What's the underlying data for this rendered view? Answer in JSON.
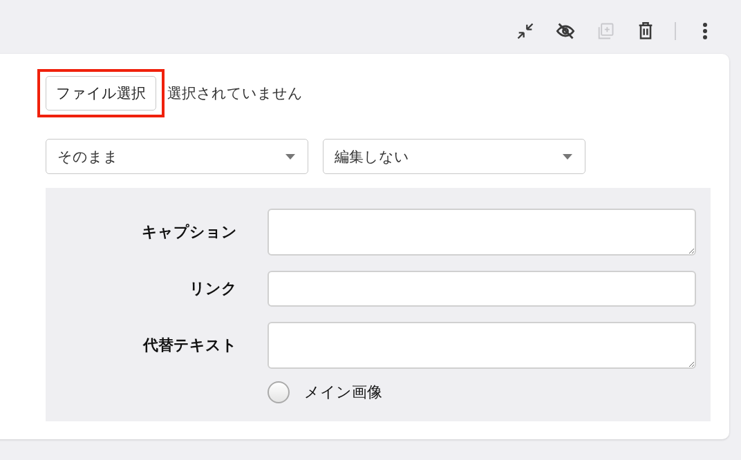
{
  "toolbar": [
    {
      "kind": "collapse",
      "disabled": false
    },
    {
      "kind": "hide",
      "disabled": false
    },
    {
      "kind": "duplicate",
      "disabled": true
    },
    {
      "kind": "delete",
      "disabled": false
    },
    {
      "kind": "more",
      "disabled": false
    }
  ],
  "file_picker": {
    "button": "ファイル選択",
    "status": "選択されていません",
    "highlighted": true
  },
  "selects": [
    {
      "value": "そのまま"
    },
    {
      "value": "編集しない"
    }
  ],
  "fields": [
    {
      "label": "キャプション",
      "kind": "textarea"
    },
    {
      "label": "リンク",
      "kind": "input"
    },
    {
      "label": "代替テキスト",
      "kind": "textarea"
    }
  ],
  "radio": {
    "label": "メイン画像",
    "selected": false
  }
}
